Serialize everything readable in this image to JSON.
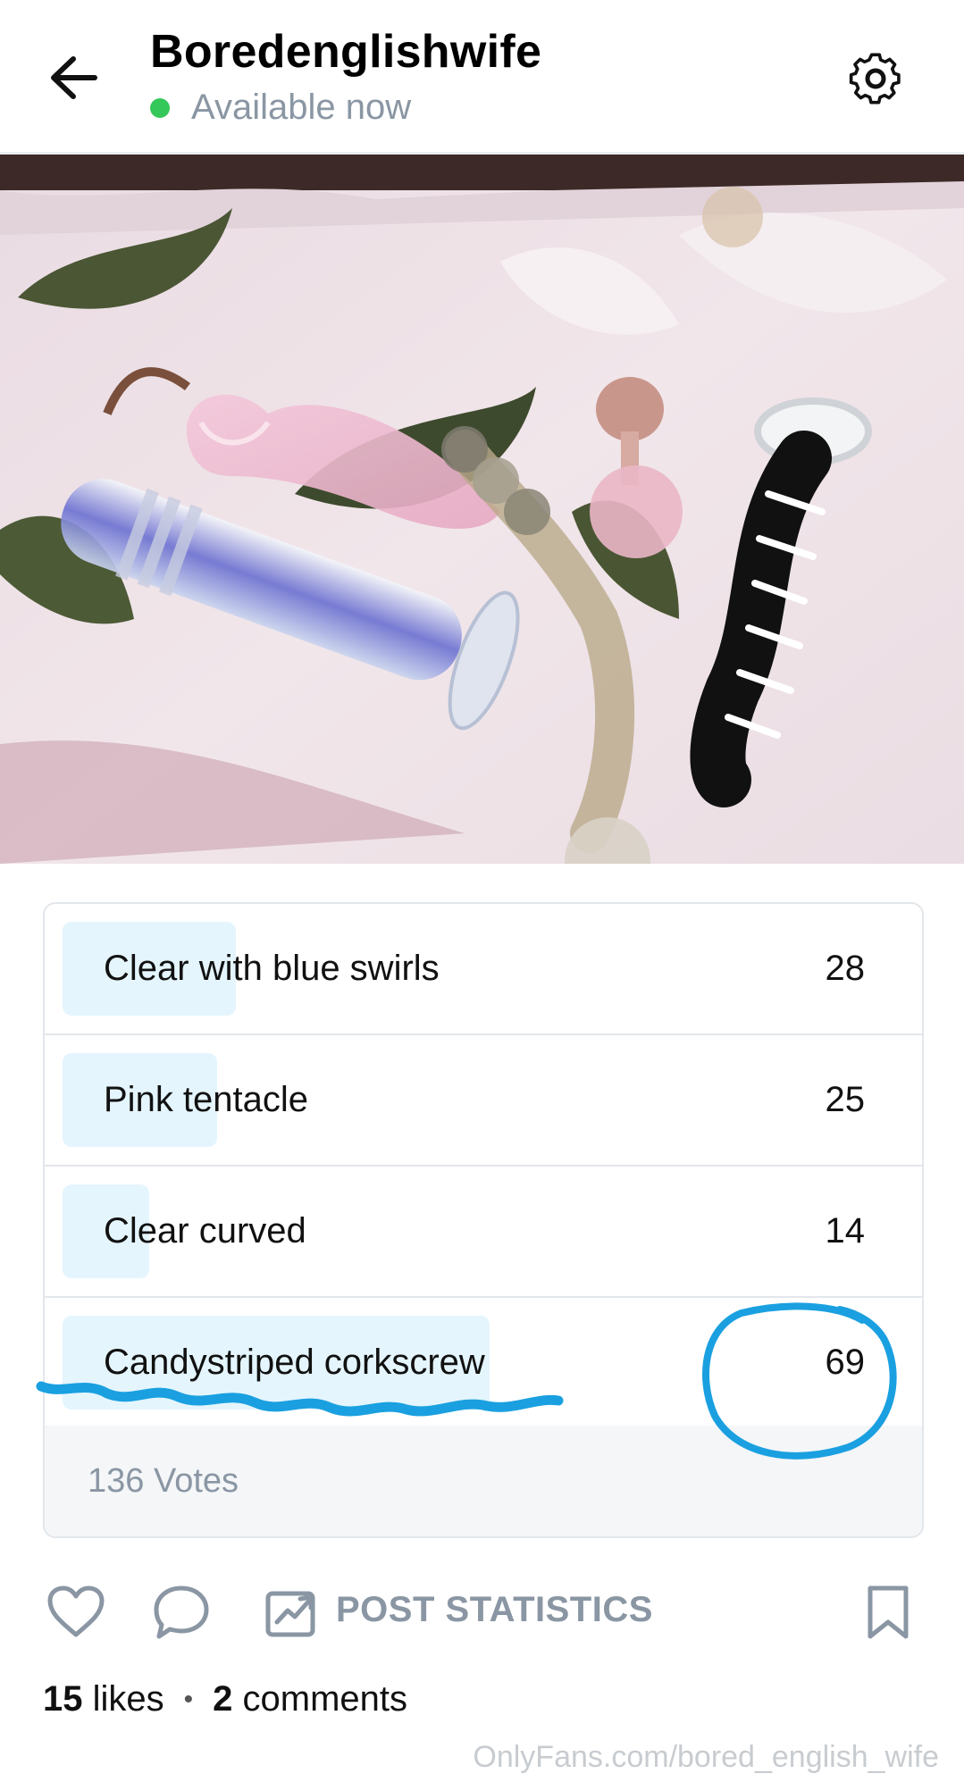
{
  "header": {
    "title": "Boredenglishwife",
    "status": "Available now",
    "status_color": "#34c759"
  },
  "icons": {
    "back": "arrow-left-icon",
    "settings": "gear-icon",
    "like": "heart-icon",
    "comment": "comment-icon",
    "stats": "chart-icon",
    "bookmark": "bookmark-icon"
  },
  "poll": {
    "options": [
      {
        "label": "Clear with blue swirls",
        "count": "28",
        "votes": 28
      },
      {
        "label": "Pink tentacle",
        "count": "25",
        "votes": 25
      },
      {
        "label": "Clear curved",
        "count": "14",
        "votes": 14
      },
      {
        "label": "Candystriped corkscrew",
        "count": "69",
        "votes": 69
      }
    ],
    "total": "136 Votes",
    "bar_color": "#e4f5fd"
  },
  "actions": {
    "stats_label": "POST STATISTICS"
  },
  "meta": {
    "likes_count": "15",
    "likes_word": "likes",
    "comments_count": "2",
    "comments_word": "comments",
    "separator": "•"
  },
  "watermark": "OnlyFans.com/bored_english_wife",
  "annotation_color": "#1aa0e0"
}
